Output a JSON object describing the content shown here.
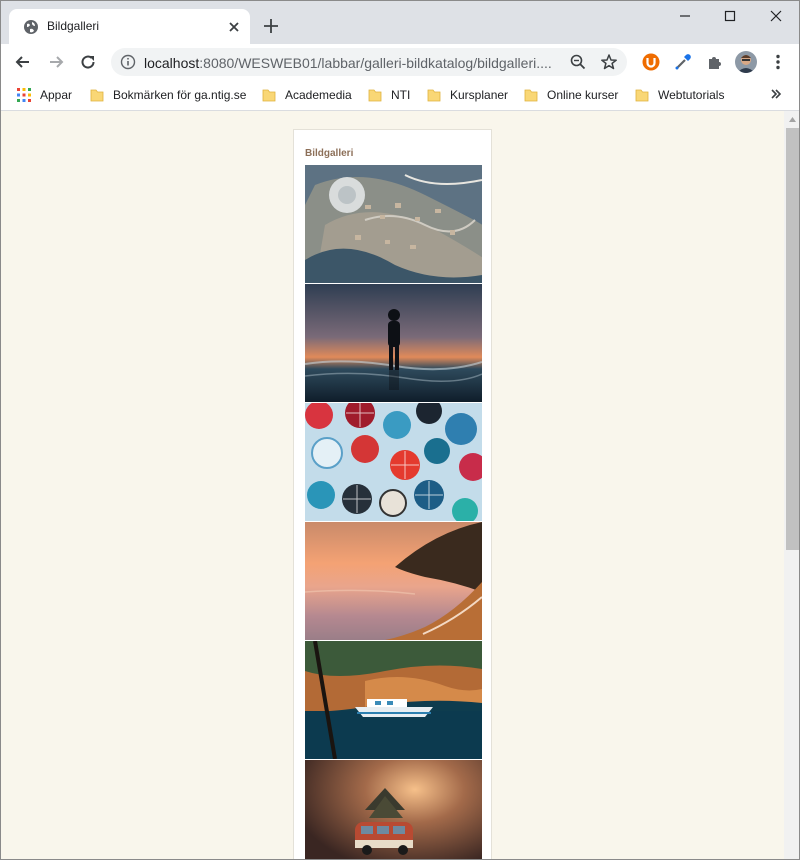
{
  "browser": {
    "tab_title": "Bildgalleri",
    "url_host": "localhost",
    "url_rest": ":8080/WESWEB01/labbar/galleri-bildkatalog/bildgalleri....",
    "accent_color": "#1a73e8",
    "ublock_color": "#ef6c00"
  },
  "bookmarks": [
    {
      "label": "Appar",
      "icon": "apps-grid-icon"
    },
    {
      "label": "Bokmärken för ga.ntig.se",
      "icon": "folder-icon"
    },
    {
      "label": "Academedia",
      "icon": "folder-icon"
    },
    {
      "label": "NTI",
      "icon": "folder-icon"
    },
    {
      "label": "Kursplaner",
      "icon": "folder-icon"
    },
    {
      "label": "Online kurser",
      "icon": "folder-icon"
    },
    {
      "label": "Webtutorials",
      "icon": "folder-icon"
    }
  ],
  "page": {
    "heading": "Bildgalleri",
    "heading_color": "#8c6f58",
    "background_color": "#f9f6ec"
  },
  "gallery": [
    {
      "subject": "aerial-town-photo"
    },
    {
      "subject": "sunset-beach-silhouette-photo"
    },
    {
      "subject": "umbrellas-pattern-photo"
    },
    {
      "subject": "sunset-bay-photo"
    },
    {
      "subject": "boat-cliff-photo"
    },
    {
      "subject": "toy-van-christmas-photo"
    }
  ]
}
